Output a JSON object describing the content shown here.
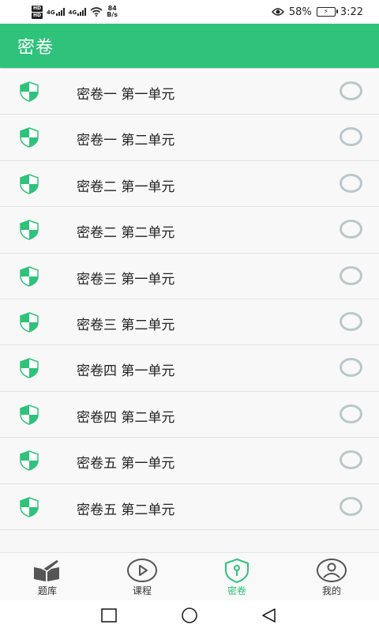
{
  "status_bar": {
    "hd_top": "HD",
    "hd_bottom": "HD",
    "net1": "4G",
    "net2": "4G",
    "speed_value": "84",
    "speed_unit": "B/s",
    "battery_percent": "58%",
    "time": "3:22"
  },
  "app_bar": {
    "title": "密卷"
  },
  "list": {
    "items": [
      {
        "label": "密卷一 第一单元"
      },
      {
        "label": "密卷一 第二单元"
      },
      {
        "label": "密卷二 第一单元"
      },
      {
        "label": "密卷二 第二单元"
      },
      {
        "label": "密卷三 第一单元"
      },
      {
        "label": "密卷三 第二单元"
      },
      {
        "label": "密卷四 第一单元"
      },
      {
        "label": "密卷四 第二单元"
      },
      {
        "label": "密卷五 第一单元"
      },
      {
        "label": "密卷五 第二单元"
      }
    ]
  },
  "tab_bar": {
    "tabs": [
      {
        "label": "题库",
        "icon": "book-pen-icon"
      },
      {
        "label": "课程",
        "icon": "play-circle-icon"
      },
      {
        "label": "密卷",
        "icon": "shield-lock-icon"
      },
      {
        "label": "我的",
        "icon": "user-circle-icon"
      }
    ],
    "active_tab": "密卷"
  },
  "colors": {
    "accent": "#2fc27b",
    "radio_border": "#b9c7cb",
    "background": "#f7f7f7"
  }
}
